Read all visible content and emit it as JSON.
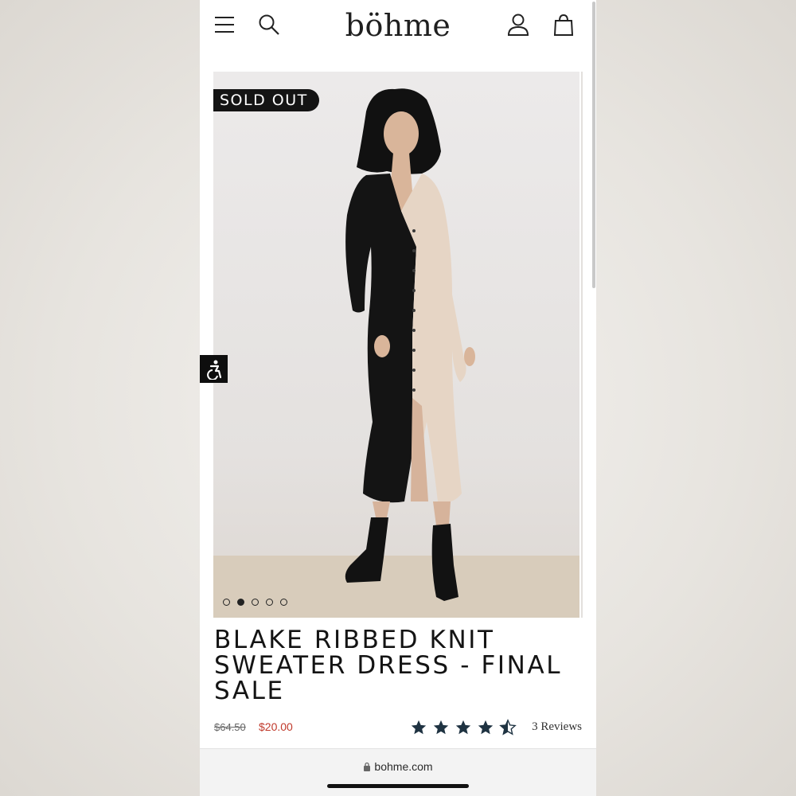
{
  "header": {
    "logo": "böhme",
    "menu_icon": "hamburger-menu-icon",
    "search_icon": "search-icon",
    "account_icon": "user-icon",
    "cart_icon": "shopping-bag-icon"
  },
  "product": {
    "badge": "SOLD OUT",
    "title": "BLAKE RIBBED KNIT SWEATER DRESS - FINAL SALE",
    "original_price": "$64.50",
    "sale_price": "$20.00",
    "rating": 4.5,
    "reviews": "3 Reviews",
    "carousel": {
      "total": 5,
      "active_index": 1
    }
  },
  "accessibility_button": {
    "icon": "accessibility-icon"
  },
  "browser": {
    "url": "bohme.com",
    "lock_icon": "lock-icon"
  },
  "colors": {
    "sale_price": "#c0392b",
    "text": "#141414",
    "badge_bg": "#141414",
    "star": "#1f3342"
  }
}
